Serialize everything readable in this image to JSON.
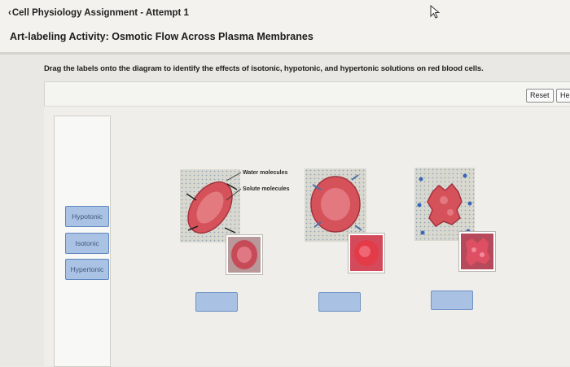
{
  "header": {
    "back_label": "Cell Physiology Assignment - Attempt 1",
    "title": "Art-labeling Activity: Osmotic Flow Across Plasma Membranes"
  },
  "activity": {
    "instructions": "Drag the labels onto the diagram to identify the effects of isotonic, hypotonic, and hypertonic solutions on red blood cells.",
    "reset_label": "Reset",
    "help_label": "He",
    "labels": [
      "Hypotonic",
      "Isotonic",
      "Hypertonic"
    ],
    "callouts": {
      "water": "Water molecules",
      "solute": "Solute molecules"
    }
  },
  "colors": {
    "label_fill": "#aac2e3",
    "label_border": "#5e87bf",
    "cell_red": "#d5525a",
    "panel_bg": "#d9d8cf"
  }
}
